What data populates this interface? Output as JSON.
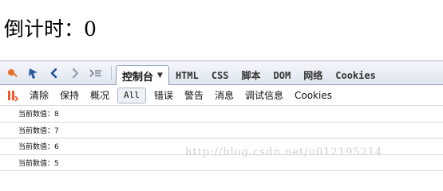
{
  "page": {
    "countdown_text": "倒计时：0"
  },
  "devtools": {
    "toolbar_icons": [
      "inspect-icon",
      "cursor-icon",
      "back-icon",
      "forward-icon",
      "command-line-icon"
    ],
    "tabs": [
      "控制台",
      "HTML",
      "CSS",
      "脚本",
      "DOM",
      "网络",
      "Cookies"
    ],
    "selected_tab": "控制台",
    "toolbar": {
      "stop_icon": "stop-icon",
      "buttons": [
        "清除",
        "保持",
        "概况",
        "All",
        "错误",
        "警告",
        "消息",
        "调试信息",
        "Cookies"
      ]
    },
    "console_lines": [
      "当前数值：8",
      "当前数值：7",
      "当前数值：6",
      "当前数值：5"
    ]
  },
  "watermark": {
    "text": "http://blog.csdn.net/u012195214"
  },
  "colors": {
    "accent": "#1d4f98",
    "tab_border": "#8b9db5",
    "row_border": "#d7d7d7",
    "watermark": "#cfcfcf"
  }
}
